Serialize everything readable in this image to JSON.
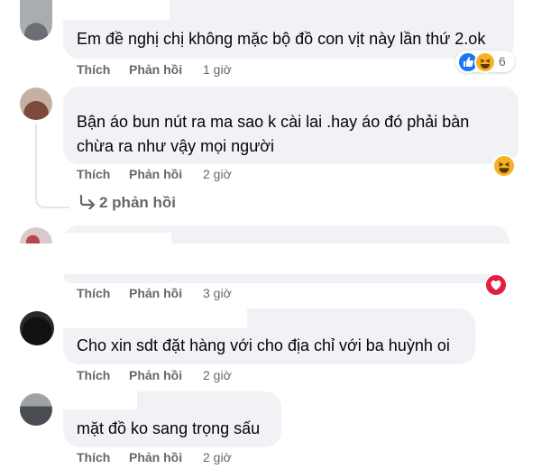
{
  "comments": [
    {
      "text": "Em đề nghị chị không mặc bộ đồ con vịt này lần thứ 2.ok",
      "like_label": "Thích",
      "reply_label": "Phản hồi",
      "time": "1 giờ",
      "reaction_count": "6",
      "reactions": [
        "like-icon",
        "haha-icon"
      ]
    },
    {
      "text_line1": "Bận áo bun nút ra ma sao k cài lai .hay áo đó phải bàn",
      "text_line2": "chừa ra như vậy mọi người",
      "like_label": "Thích",
      "reply_label": "Phản hồi",
      "time": "2 giờ",
      "reactions": [
        "haha-icon"
      ],
      "replies_link": "2 phản hồi"
    },
    {
      "text": "",
      "like_label": "Thích",
      "reply_label": "Phản hồi",
      "time": "3 giờ",
      "reactions": [
        "heart-icon"
      ]
    },
    {
      "text": "Cho xin sdt đặt hàng với cho địa chỉ với ba huỳnh oi",
      "like_label": "Thích",
      "reply_label": "Phản hồi",
      "time": "2 giờ"
    },
    {
      "text": "mặt đồ ko sang trọng sấu",
      "like_label": "Thích",
      "reply_label": "Phản hồi",
      "time": "2 giờ"
    }
  ],
  "colors": {
    "bubble": "#f0f2f5",
    "meta_text": "#65676b",
    "like_blue": "#1877f2",
    "haha_yellow": "#f7b125",
    "heart_red": "#e41e3f"
  }
}
